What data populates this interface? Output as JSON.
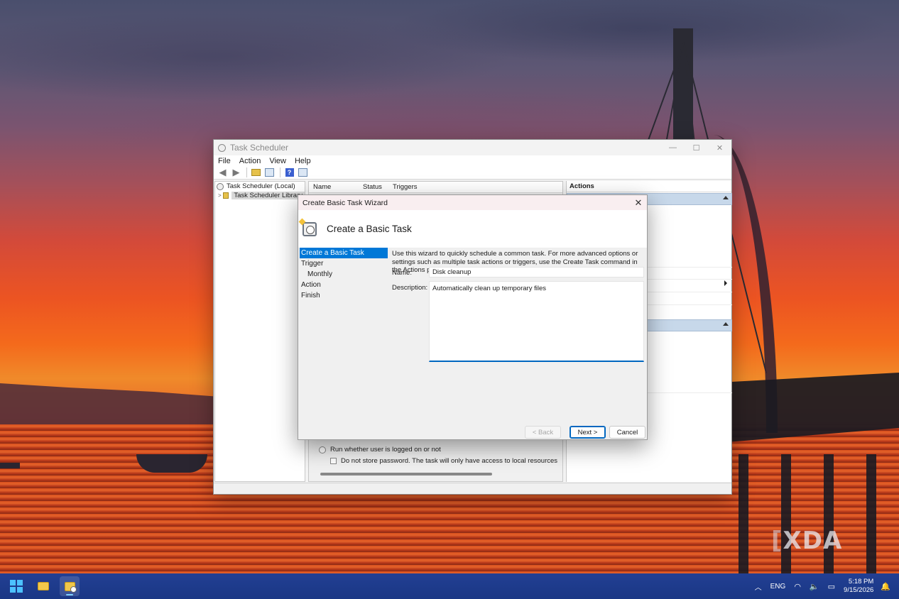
{
  "main_window": {
    "title": "Task Scheduler",
    "controls": {
      "minimize": "—",
      "maximize": "☐",
      "close": "✕"
    },
    "menu": [
      "File",
      "Action",
      "View",
      "Help"
    ],
    "tree": {
      "root": "Task Scheduler (Local)",
      "library": "Task Scheduler Library"
    },
    "columns": [
      "Name",
      "Status",
      "Triggers"
    ],
    "options": {
      "run_whether": "Run whether user is logged on or not",
      "no_password": "Do not store password.  The task will only have access to local resources"
    },
    "actions_title": "Actions"
  },
  "wizard": {
    "title": "Create Basic Task Wizard",
    "close": "✕",
    "heading": "Create a Basic Task",
    "steps": [
      "Create a Basic Task",
      "Trigger",
      "Monthly",
      "Action",
      "Finish"
    ],
    "intro": "Use this wizard to quickly schedule a common task.  For more advanced options or settings such as multiple task actions or triggers, use the Create Task command in the Actions pane.",
    "name_label": "Name:",
    "name_value": "Disk cleanup",
    "description_label": "Description:",
    "description_value": "Automatically clean up temporary files",
    "buttons": {
      "back": "< Back",
      "next": "Next >",
      "cancel": "Cancel"
    }
  },
  "taskbar": {
    "language": "ENG",
    "time": "5:18 PM",
    "date": "9/15/2026"
  },
  "watermark": {
    "bracket": "[",
    "text": "XDA"
  },
  "colors": {
    "accent": "#0078d7",
    "taskbar": "#1d3b8e"
  }
}
